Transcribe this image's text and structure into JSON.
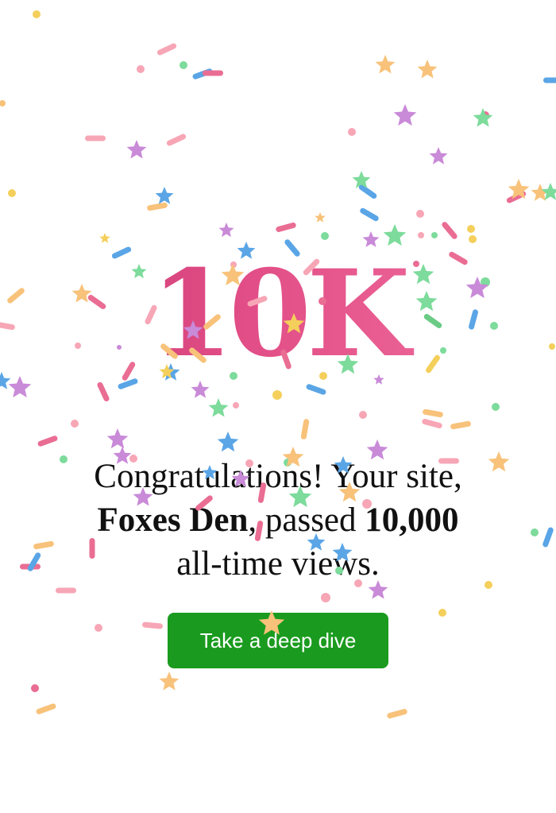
{
  "milestone": {
    "headline": "10K"
  },
  "message": {
    "prefix": "Congratulations! Your site,",
    "site_name": "Foxes Den",
    "middle": ", passed ",
    "count": "10,000",
    "suffix": "all-time views."
  },
  "cta": {
    "label": "Take a deep dive"
  },
  "colors": {
    "headline_gradient": [
      "#c93a72",
      "#f0709f"
    ],
    "button": "#1a9b1f",
    "confetti": [
      "#f7a6b6",
      "#5aa5e6",
      "#7ddb9b",
      "#f8c27a",
      "#c98ad8",
      "#f4cf5b",
      "#ea6d93",
      "#3fa7e0",
      "#6acb85"
    ]
  }
}
